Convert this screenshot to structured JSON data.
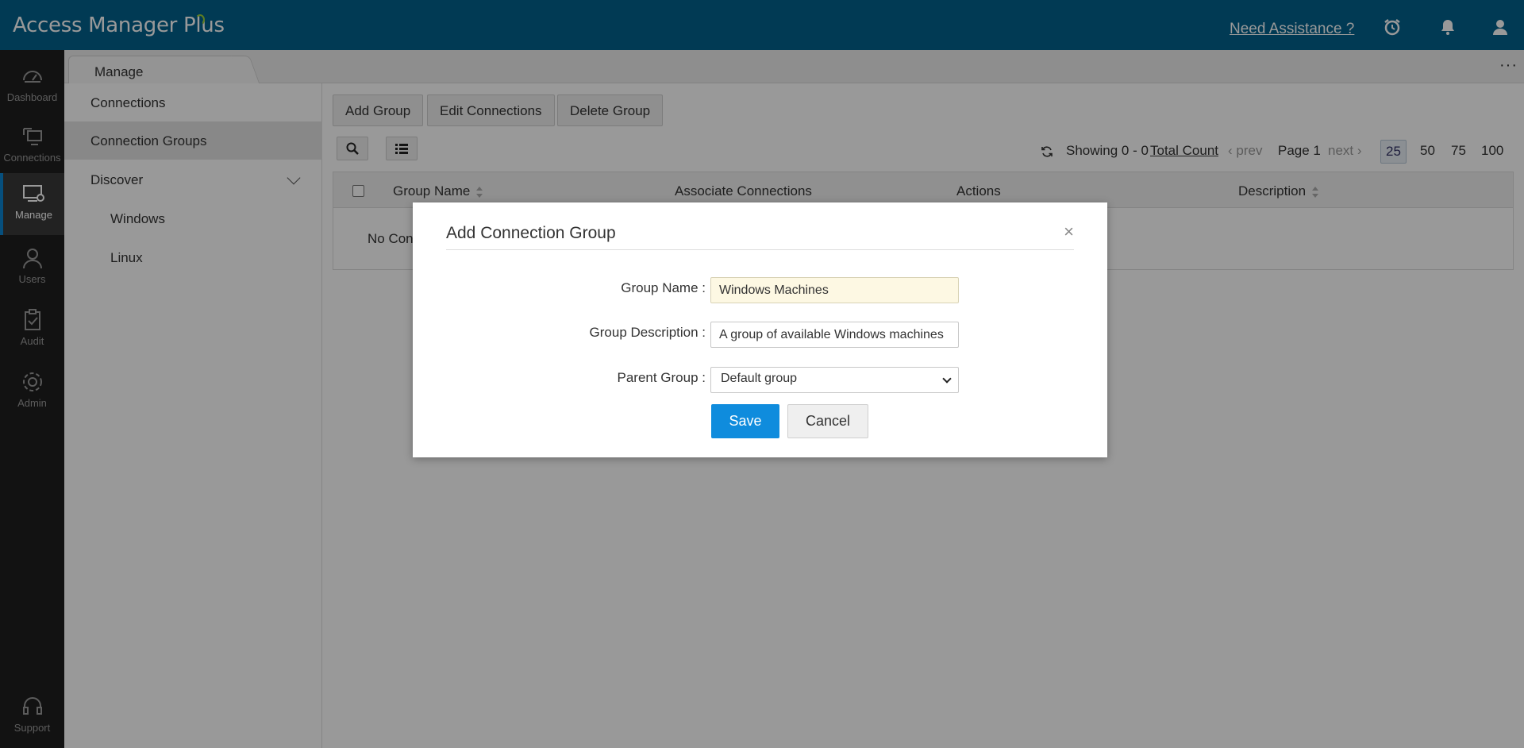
{
  "header": {
    "app_title": "Access Manager Plus",
    "assist_link": "Need Assistance ?",
    "icons": [
      "alarm-clock-icon",
      "bell-icon",
      "user-icon"
    ],
    "background_color": "#03618c"
  },
  "leftnav": {
    "items": [
      {
        "label": "Dashboard",
        "icon": "dashboard-icon"
      },
      {
        "label": "Connections",
        "icon": "connections-icon"
      },
      {
        "label": "Manage",
        "icon": "manage-icon",
        "active": true
      },
      {
        "label": "Users",
        "icon": "users-icon"
      },
      {
        "label": "Audit",
        "icon": "audit-icon"
      },
      {
        "label": "Admin",
        "icon": "admin-gear-icon"
      }
    ],
    "support_label": "Support"
  },
  "tabstrip": {
    "active_tab": "Manage",
    "more_label": "···"
  },
  "subnav": {
    "items": [
      {
        "label": "Connections"
      },
      {
        "label": "Connection Groups",
        "active": true
      },
      {
        "label": "Discover",
        "expandable": true
      },
      {
        "label": "Windows"
      },
      {
        "label": "Linux"
      }
    ]
  },
  "toolbar": {
    "add_group": "Add Group",
    "edit_connections": "Edit Connections",
    "delete_group": "Delete Group"
  },
  "pager": {
    "showing": "Showing 0 - 0",
    "total_count": "Total Count",
    "prev": "prev",
    "page": "Page 1",
    "next": "next",
    "page_sizes": [
      "25",
      "50",
      "75",
      "100"
    ],
    "selected_page_size": "25"
  },
  "table": {
    "columns": [
      "Group Name",
      "Associate Connections",
      "Actions",
      "Description"
    ],
    "empty_message": "No Con"
  },
  "modal": {
    "title": "Add Connection Group",
    "close_symbol": "×",
    "fields": {
      "group_name_label": "Group Name :",
      "group_name_value": "Windows Machines",
      "group_description_label": "Group Description :",
      "group_description_value": "A group of available Windows machines",
      "parent_group_label": "Parent Group :",
      "parent_group_value": "Default group"
    },
    "save_label": "Save",
    "cancel_label": "Cancel"
  }
}
